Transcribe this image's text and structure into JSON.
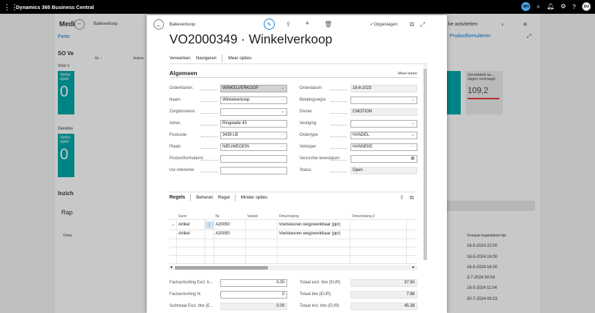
{
  "app": {
    "name": "Dynamics 365 Business Central",
    "user_initials_1": "MH",
    "user_initials_2": "DU"
  },
  "background": {
    "title": "Medi",
    "nav1": "Partic",
    "section1": "SO Ve",
    "section1_sub": "Voor v",
    "tile1_text": "Verko open",
    "tile1_value": "0",
    "section2_sub": "Geretou",
    "tile2_text": "Verko open",
    "tile2_value": "0",
    "insight": "Inzich",
    "rap": "Rap",
    "omsc": "Omsc",
    "activities": "ke activiteiten",
    "productformulieren": "Productformulieren",
    "stat_label": "Gemiddeld aa... dagen verstraagd",
    "stat_label_display": "Gemiddeld aa...\ndagen vertraagd",
    "stat_value": "109,2",
    "col_header": "Vroegste begindatum/-tijd",
    "dates": [
      "16-5-2024 22:00",
      "16-5-2024 16:00",
      "16-5-2024 16:00",
      "3-7-2024 00:04",
      "16-5-2024 11:04",
      "30-7-2024 09:33"
    ],
    "left_list_header": "Nr. ↑",
    "left_list_header2": "Verkoo",
    "left_crumb": "Balieverkoop"
  },
  "modal": {
    "breadcrumb": "Balieverkoop",
    "saved_status": "Opgeslagen",
    "title": "VO2000349 · Winkelverkoop",
    "actions": [
      "Verwerken",
      "Navigeren",
      "Meer opties"
    ],
    "section_title": "Algemeen",
    "show_more": "Meer tonen",
    "left_fields": [
      {
        "label": "Orderklantnr.",
        "value": "WINKELVERKOOP",
        "suffix": "⌄"
      },
      {
        "label": "Naam",
        "value": "Winkelverkoop",
        "suffix": "···"
      },
      {
        "label": "Zorgdossiernr.",
        "value": "",
        "suffix": "⌄"
      },
      {
        "label": "Adres",
        "value": "Ringwade 43",
        "suffix": ""
      },
      {
        "label": "Postcode",
        "value": "3439 LB",
        "suffix": "···"
      },
      {
        "label": "Plaats",
        "value": "NIEUWEGEIN",
        "suffix": "···"
      },
      {
        "label": "Productformuliernr.",
        "value": "",
        "suffix": ""
      },
      {
        "label": "Uw referentie",
        "value": "",
        "suffix": ""
      }
    ],
    "right_fields": [
      {
        "label": "Orderdatum",
        "value": "18-8-2023",
        "suffix": ""
      },
      {
        "label": "Betalingswijze",
        "value": "",
        "suffix": "⌄"
      },
      {
        "label": "Divisie",
        "value": "CMOTION",
        "suffix": ""
      },
      {
        "label": "Vestiging",
        "value": "",
        "suffix": "⌄"
      },
      {
        "label": "Ordertype",
        "value": "HANDEL",
        "suffix": "⌄"
      },
      {
        "label": "Verkoper",
        "value": "HANNEKE",
        "suffix": "···"
      },
      {
        "label": "Verzochte leverdatum",
        "value": "",
        "suffix": "▦"
      },
      {
        "label": "Status",
        "value": "Open",
        "suffix": ""
      }
    ],
    "lines": {
      "title": "Regels",
      "actions": [
        "Beheren",
        "Regel",
        "Minder opties"
      ],
      "columns": [
        "Soort",
        "Nr.",
        "Variant",
        "Omschrijving",
        "Omschrijving 2"
      ],
      "rows": [
        {
          "arrow": "→",
          "soort": "Artikel",
          "nr": "A20050",
          "variant": "",
          "omschrijving": "Voetsteunen wegzwenkbaar (ppr)",
          "omschrijving2": ""
        },
        {
          "arrow": "",
          "soort": "Artikel",
          "nr": "A20050",
          "variant": "",
          "omschrijving": "Voetsteunen wegzwenkbaar (ppr)",
          "omschrijving2": ""
        }
      ]
    },
    "totals_left": [
      {
        "label": "Factuurkorting Excl. b...",
        "value": "0.00"
      },
      {
        "label": "Factuurkorting %",
        "value": "0"
      },
      {
        "label": "Subtotaal Excl. btw (E...",
        "value": "0.00"
      }
    ],
    "totals_right": [
      {
        "label": "Totaal excl. btw (EUR)",
        "value": "37.50"
      },
      {
        "label": "Totaal btw (EUR)",
        "value": "7.88"
      },
      {
        "label": "Totaal incl. btw (EUR)",
        "value": "45.38"
      }
    ]
  }
}
